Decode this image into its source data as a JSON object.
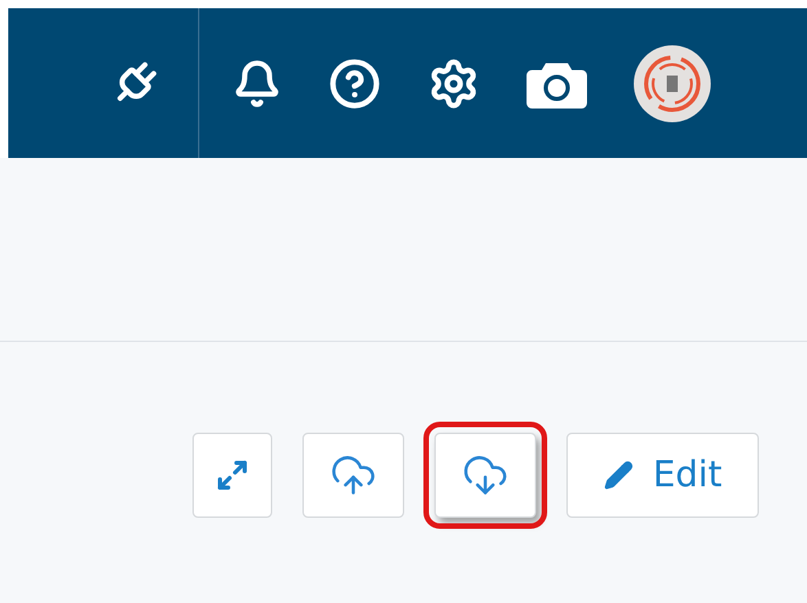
{
  "header": {
    "icons": [
      {
        "kind": "plug"
      },
      {
        "kind": "bell"
      },
      {
        "kind": "help"
      },
      {
        "kind": "settings"
      },
      {
        "kind": "camera"
      },
      {
        "kind": "avatar"
      }
    ]
  },
  "toolbar": {
    "buttons": [
      {
        "kind": "expand",
        "highlighted": false
      },
      {
        "kind": "upload",
        "highlighted": false
      },
      {
        "kind": "download",
        "highlighted": true
      },
      {
        "kind": "edit",
        "label": "Edit",
        "highlighted": false
      }
    ]
  }
}
